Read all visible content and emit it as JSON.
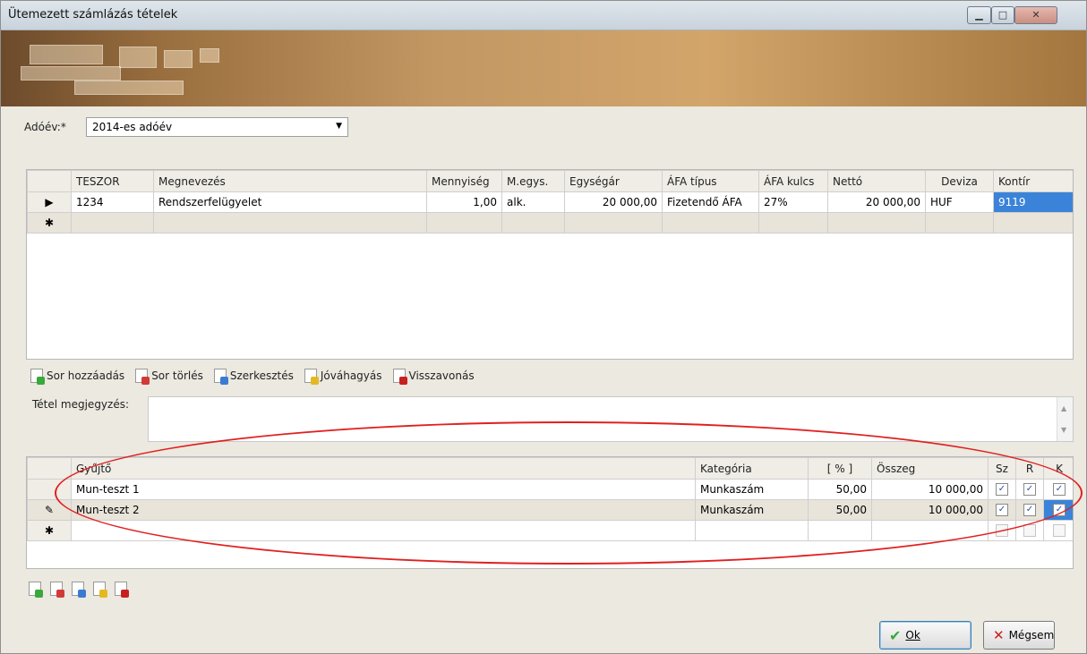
{
  "window": {
    "title": "Ütemezett számlázás tételek"
  },
  "form": {
    "year_label": "Adóév:*",
    "year_value": "2014-es adóév"
  },
  "items_table": {
    "columns": [
      "TESZOR",
      "Megnevezés",
      "Mennyiség",
      "M.egys.",
      "Egységár",
      "ÁFA típus",
      "ÁFA kulcs",
      "Nettó",
      "Deviza",
      "Kontír"
    ],
    "rows": [
      {
        "indicator": "▶",
        "teszor": "1234",
        "name": "Rendszerfelügyelet",
        "qty": "1,00",
        "unit": "alk.",
        "unit_price": "20 000,00",
        "vat_type": "Fizetendő ÁFA",
        "vat_rate": "27%",
        "net": "20 000,00",
        "currency": "HUF",
        "account": "9119"
      }
    ],
    "new_row_indicator": "✱"
  },
  "toolbar": {
    "add": "Sor hozzáadás",
    "delete": "Sor törlés",
    "edit": "Szerkesztés",
    "approve": "Jóváhagyás",
    "revoke": "Visszavonás"
  },
  "note": {
    "label": "Tétel megjegyzés:",
    "value": ""
  },
  "collector_table": {
    "columns": [
      "Gyűjtő",
      "Kategória",
      "[ % ]",
      "Összeg",
      "Sz",
      "R",
      "K"
    ],
    "rows": [
      {
        "indicator": "",
        "collector": "Mun-teszt 1",
        "category": "Munkaszám",
        "percent": "50,00",
        "amount": "10 000,00",
        "sz": true,
        "r": true,
        "k": true
      },
      {
        "indicator": "✎",
        "collector": "Mun-teszt 2",
        "category": "Munkaszám",
        "percent": "50,00",
        "amount": "10 000,00",
        "sz": true,
        "r": true,
        "k": true
      }
    ],
    "new_row_indicator": "✱"
  },
  "buttons": {
    "ok": "Ok",
    "cancel": "Mégsem"
  },
  "colors": {
    "annotation": "#e02020",
    "selection": "#3b83d9"
  }
}
